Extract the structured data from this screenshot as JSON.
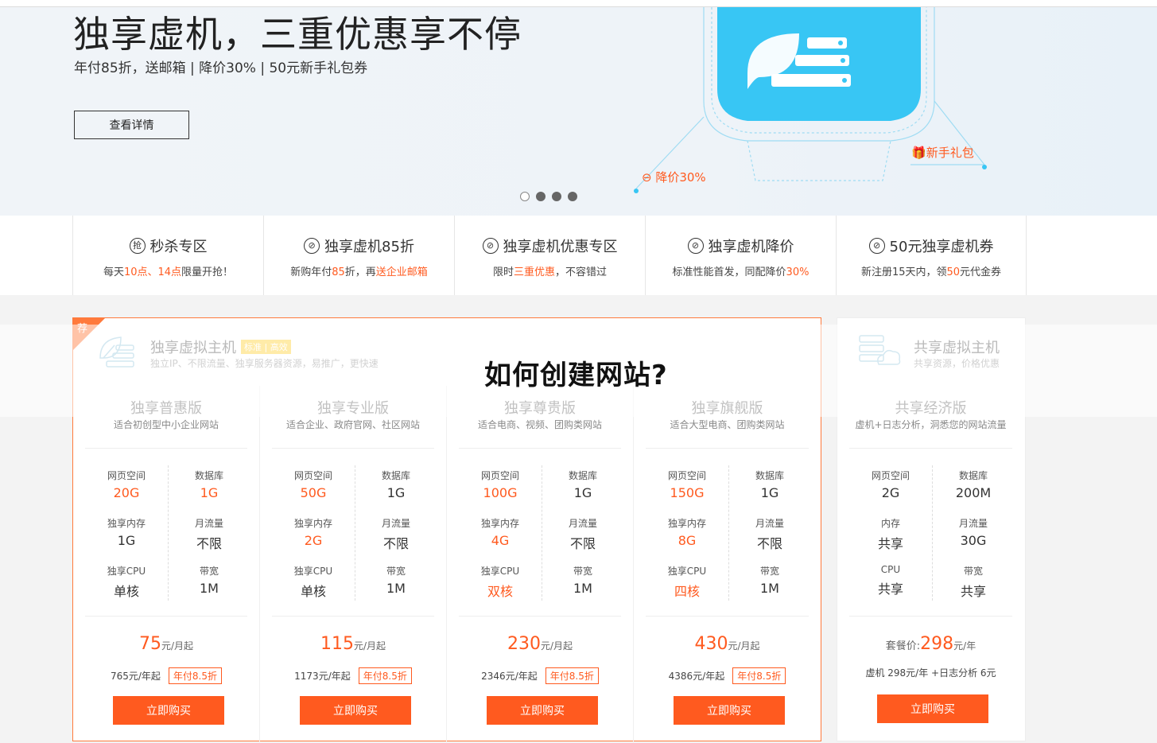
{
  "banner": {
    "title": "独享虚机，三重优惠享不停",
    "subtitle": "年付85折，送邮箱 | 降价30% | 50元新手礼包券",
    "button": "查看详情",
    "tag_down": "降价30%",
    "tag_gift": "新手礼包",
    "slides": 4,
    "active_slide": 0
  },
  "promos": [
    {
      "icon": "抢",
      "title": "秒杀专区",
      "desc": [
        {
          "t": "每天"
        },
        {
          "t": "10点、14点",
          "hl": true
        },
        {
          "t": "限量开抢！"
        }
      ]
    },
    {
      "icon": "⊘",
      "title": "独享虚机85折",
      "desc": [
        {
          "t": "新购年付"
        },
        {
          "t": "85",
          "hl": true
        },
        {
          "t": "折，再"
        },
        {
          "t": "送企业邮箱",
          "hl": true
        }
      ]
    },
    {
      "icon": "⊘",
      "title": "独享虚机优惠专区",
      "desc": [
        {
          "t": "限时"
        },
        {
          "t": "三重优惠",
          "hl": true
        },
        {
          "t": "，不容错过"
        }
      ]
    },
    {
      "icon": "⊘",
      "title": "独享虚机降价",
      "desc": [
        {
          "t": "标准性能首发，同配降价"
        },
        {
          "t": "30%",
          "hl": true
        }
      ]
    },
    {
      "icon": "⊘",
      "title": "50元独享虚机券",
      "desc": [
        {
          "t": "新注册15天内，领"
        },
        {
          "t": "50",
          "hl": true
        },
        {
          "t": "元代金券"
        }
      ]
    }
  ],
  "exclusive": {
    "corner": "荐",
    "title": "独享虚拟主机",
    "badge": "标准 | 高效",
    "subtitle": "独立IP、不限流量、独享服务器资源，易推广，更快速"
  },
  "shared": {
    "title": "共享虚拟主机",
    "subtitle": "共享资源，价格优惠"
  },
  "overlay_title": "如何创建网站?",
  "plans": [
    {
      "name": "独享普惠版",
      "desc": "适合初创型中小企业网站",
      "specs": [
        {
          "l": "网页空间",
          "v": "20G",
          "hl": true
        },
        {
          "l": "数据库",
          "v": "1G",
          "hl": true
        },
        {
          "l": "独享内存",
          "v": "1G"
        },
        {
          "l": "月流量",
          "v": "不限"
        },
        {
          "l": "独享CPU",
          "v": "单核"
        },
        {
          "l": "带宽",
          "v": "1M"
        }
      ],
      "price": "75",
      "unit": "元/月起",
      "yearly": "765元/年起",
      "disc": "年付8.5折",
      "buy": "立即购买"
    },
    {
      "name": "独享专业版",
      "desc": "适合企业、政府官网、社区网站",
      "specs": [
        {
          "l": "网页空间",
          "v": "50G",
          "hl": true
        },
        {
          "l": "数据库",
          "v": "1G"
        },
        {
          "l": "独享内存",
          "v": "2G",
          "hl": true
        },
        {
          "l": "月流量",
          "v": "不限"
        },
        {
          "l": "独享CPU",
          "v": "单核"
        },
        {
          "l": "带宽",
          "v": "1M"
        }
      ],
      "price": "115",
      "unit": "元/月起",
      "yearly": "1173元/年起",
      "disc": "年付8.5折",
      "buy": "立即购买"
    },
    {
      "name": "独享尊贵版",
      "desc": "适合电商、视频、团购类网站",
      "specs": [
        {
          "l": "网页空间",
          "v": "100G",
          "hl": true
        },
        {
          "l": "数据库",
          "v": "1G"
        },
        {
          "l": "独享内存",
          "v": "4G",
          "hl": true
        },
        {
          "l": "月流量",
          "v": "不限"
        },
        {
          "l": "独享CPU",
          "v": "双核",
          "hl": true
        },
        {
          "l": "带宽",
          "v": "1M"
        }
      ],
      "price": "230",
      "unit": "元/月起",
      "yearly": "2346元/年起",
      "disc": "年付8.5折",
      "buy": "立即购买"
    },
    {
      "name": "独享旗舰版",
      "desc": "适合大型电商、团购类网站",
      "specs": [
        {
          "l": "网页空间",
          "v": "150G",
          "hl": true
        },
        {
          "l": "数据库",
          "v": "1G"
        },
        {
          "l": "独享内存",
          "v": "8G",
          "hl": true
        },
        {
          "l": "月流量",
          "v": "不限"
        },
        {
          "l": "独享CPU",
          "v": "四核",
          "hl": true
        },
        {
          "l": "带宽",
          "v": "1M"
        }
      ],
      "price": "430",
      "unit": "元/月起",
      "yearly": "4386元/年起",
      "disc": "年付8.5折",
      "buy": "立即购买"
    }
  ],
  "shared_plan": {
    "name": "共享经济版",
    "desc": "虚机+日志分析，洞悉您的网站流量",
    "specs": [
      {
        "l": "网页空间",
        "v": "2G"
      },
      {
        "l": "数据库",
        "v": "200M"
      },
      {
        "l": "内存",
        "v": "共享"
      },
      {
        "l": "月流量",
        "v": "30G"
      },
      {
        "l": "CPU",
        "v": "共享"
      },
      {
        "l": "带宽",
        "v": "共享"
      }
    ],
    "price_label": "套餐价:",
    "price": "298",
    "unit": "元/年",
    "yearly": "虚机 298元/年 +日志分析 6元",
    "buy": "立即购买"
  },
  "colors": {
    "accent": "#ff5a1f",
    "frame": "#ff7a3c",
    "art": "#38c6f4"
  }
}
